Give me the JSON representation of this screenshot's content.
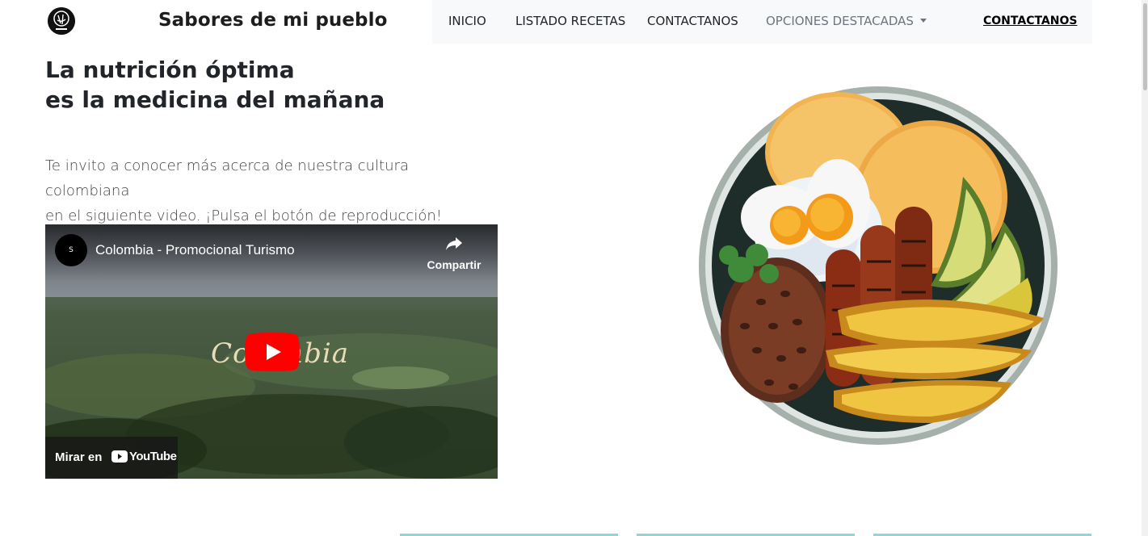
{
  "brand": {
    "site_title": "Sabores de mi pueblo",
    "logo_icon": "chef-logo-icon"
  },
  "nav": {
    "items": [
      {
        "label": "INICIO"
      },
      {
        "label": "LISTADO RECETAS"
      },
      {
        "label": "CONTACTANOS"
      },
      {
        "label": "OPCIONES DESTACADAS"
      }
    ],
    "cta_label": "CONTACTANOS",
    "dropdown_icon": "chevron-down-icon"
  },
  "hero": {
    "headline_line1": "La nutrición óptima",
    "headline_line2": "es la medicina del mañana",
    "intro_line1": "Te invito a conocer más acerca de nuestra cultura colombiana",
    "intro_line2": "en el siguiente video. ¡Pulsa el botón de reproducción!"
  },
  "video": {
    "title": "Colombia - Promocional Turismo",
    "share_label": "Compartir",
    "overlay_text": "Colombia",
    "watch_label": "Mirar en",
    "youtube_label": "YouTube",
    "play_icon": "play-icon",
    "share_icon": "share-icon",
    "colors": {
      "play_red": "#ff0000"
    }
  },
  "image": {
    "alt_icon": "bandeja-paisa-plate-illustration"
  },
  "colors": {
    "navbar_bg": "#f8f9fa",
    "card_accent": "#8fd6d6"
  }
}
